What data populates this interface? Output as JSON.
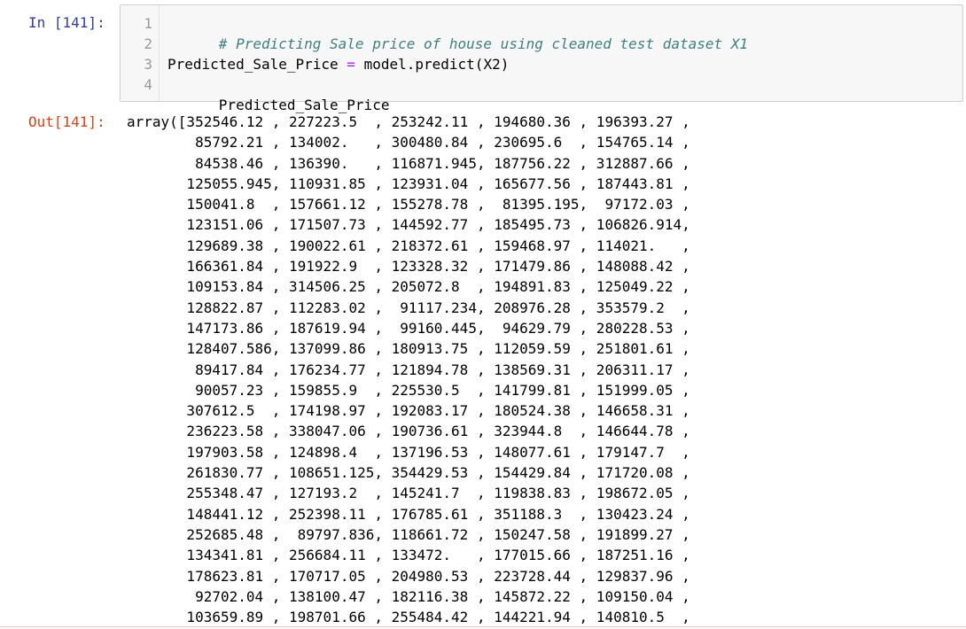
{
  "input_prompt": "In [141]:",
  "output_prompt": "Out[141]:",
  "code": {
    "line_numbers": [
      "1",
      "2",
      "3",
      "4"
    ],
    "comment": "# Predicting Sale price of house using cleaned test dataset X1",
    "line3_target": "Predicted_Sale_Price",
    "line3_op": "=",
    "line3_call": "model.predict(X2)",
    "line4": "Predicted_Sale_Price"
  },
  "output": {
    "lines": [
      "array([352546.12 , 227223.5  , 253242.11 , 194680.36 , 196393.27 ,",
      "        85792.21 , 134002.   , 300480.84 , 230695.6  , 154765.14 ,",
      "        84538.46 , 136390.   , 116871.945, 187756.22 , 312887.66 ,",
      "       125055.945, 110931.85 , 123931.04 , 165677.56 , 187443.81 ,",
      "       150041.8  , 157661.12 , 155278.78 ,  81395.195,  97172.03 ,",
      "       123151.06 , 171507.73 , 144592.77 , 185495.73 , 106826.914,",
      "       129689.38 , 190022.61 , 218372.61 , 159468.97 , 114021.   ,",
      "       166361.84 , 191922.9  , 123328.32 , 171479.86 , 148088.42 ,",
      "       109153.84 , 314506.25 , 205072.8  , 194891.83 , 125049.22 ,",
      "       128822.87 , 112283.02 ,  91117.234, 208976.28 , 353579.2  ,",
      "       147173.86 , 187619.94 ,  99160.445,  94629.79 , 280228.53 ,",
      "       128407.586, 137099.86 , 180913.75 , 112059.59 , 251801.61 ,",
      "        89417.84 , 176234.77 , 121894.78 , 138569.31 , 206311.17 ,",
      "        90057.23 , 159855.9  , 225530.5  , 141799.81 , 151999.05 ,",
      "       307612.5  , 174198.97 , 192083.17 , 180524.38 , 146658.31 ,",
      "       236223.58 , 338047.06 , 190736.61 , 323944.8  , 146644.78 ,",
      "       197903.58 , 124898.4  , 137196.53 , 148077.61 , 179147.7  ,",
      "       261830.77 , 108651.125, 354429.53 , 154429.84 , 171720.08 ,",
      "       255348.47 , 127193.2  , 145241.7  , 119838.83 , 198672.05 ,",
      "       148441.12 , 252398.11 , 176785.61 , 351188.3  , 130423.24 ,",
      "       252685.48 ,  89797.836, 118661.72 , 150247.58 , 191899.27 ,",
      "       134341.81 , 256684.11 , 133472.   , 177015.66 , 187251.16 ,",
      "       178623.81 , 170717.05 , 204980.53 , 223728.44 , 129837.96 ,",
      "        92702.04 , 138100.47 , 182116.38 , 145872.22 , 109150.04 ,",
      "       103659.89 , 198701.66 , 255484.42 , 144221.94 , 140810.5  ,"
    ]
  },
  "colors": {
    "in_prompt": "#303f9f",
    "out_prompt": "#d84315",
    "comment": "#408080",
    "operator": "#aa22ff",
    "input_background": "#f7f7f7"
  }
}
